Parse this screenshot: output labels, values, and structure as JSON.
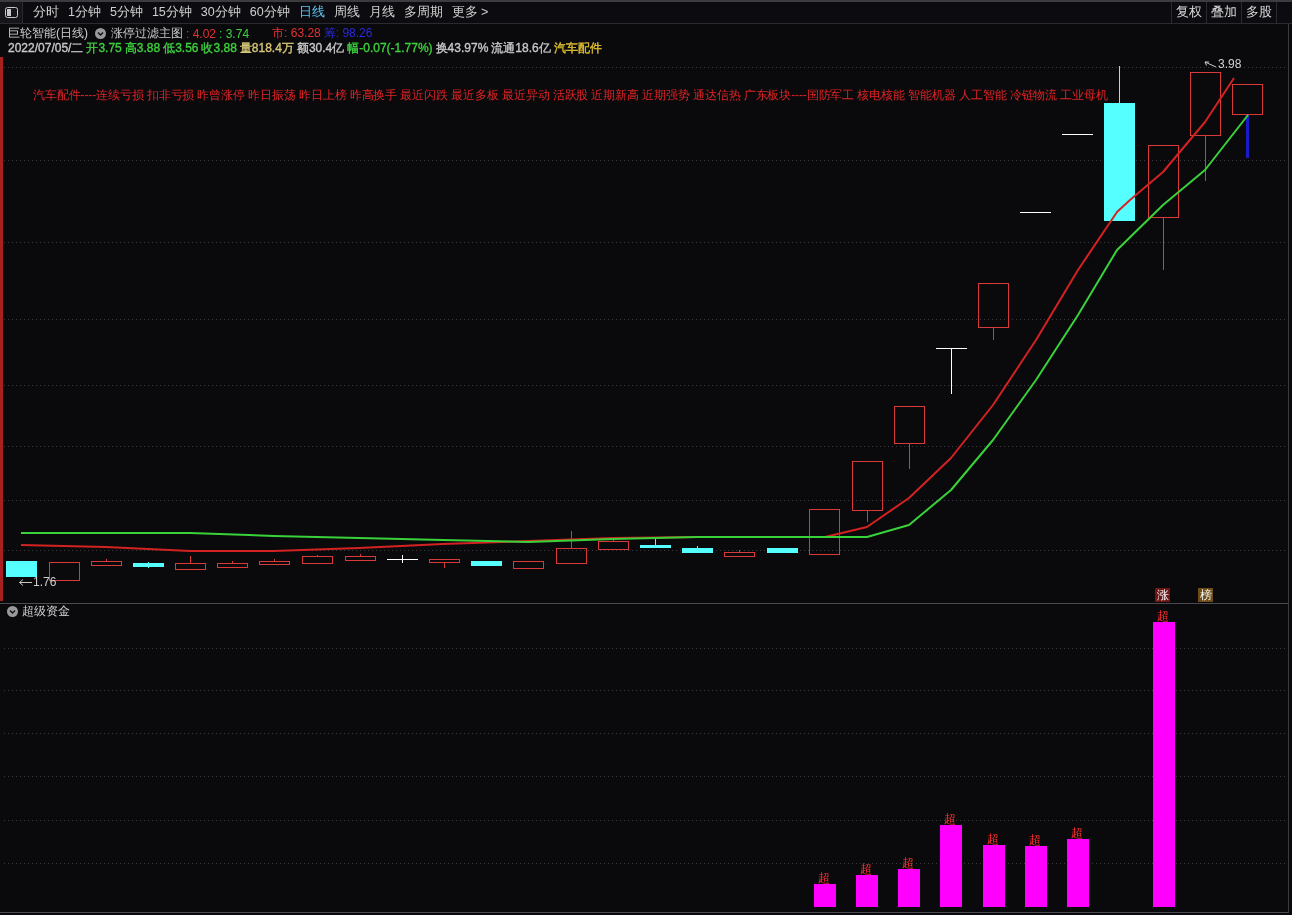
{
  "toolbar": {
    "tabs": [
      {
        "label": "分时",
        "selected": false
      },
      {
        "label": "1分钟",
        "selected": false
      },
      {
        "label": "5分钟",
        "selected": false
      },
      {
        "label": "15分钟",
        "selected": false
      },
      {
        "label": "30分钟",
        "selected": false
      },
      {
        "label": "60分钟",
        "selected": false
      },
      {
        "label": "日线",
        "selected": true
      },
      {
        "label": "周线",
        "selected": false
      },
      {
        "label": "月线",
        "selected": false
      },
      {
        "label": "多周期",
        "selected": false
      },
      {
        "label": "更多 >",
        "selected": false
      }
    ],
    "buttons": [
      "复权",
      "叠加",
      "多股"
    ]
  },
  "main_chart": {
    "title": "巨轮智能(日线)",
    "indicator_name": "涨停过滤主图",
    "indicator_values": [
      {
        "text": ": 4.02",
        "color": "#e03232"
      },
      {
        "text": ": 3.74",
        "color": "#3ed23e"
      },
      {
        "text": "市: 63.28",
        "color": "#e03232"
      },
      {
        "text": "筹: 98.26",
        "color": "#2a2ad8"
      }
    ],
    "quote": [
      {
        "text": "2022/07/05/二",
        "color": "#c8c8c8"
      },
      {
        "text": "开3.75",
        "color": "#3ed23e"
      },
      {
        "text": "高3.88",
        "color": "#3ed23e"
      },
      {
        "text": "低3.56",
        "color": "#3ed23e"
      },
      {
        "text": "收3.88",
        "color": "#3ed23e"
      },
      {
        "text": "量818.4万",
        "color": "#d8c878"
      },
      {
        "text": "额30.4亿",
        "color": "#c8c8c8"
      },
      {
        "text": "幅-0.07(-1.77%)",
        "color": "#3ed23e"
      },
      {
        "text": "换43.97%",
        "color": "#c8c8c8"
      },
      {
        "text": "流通18.6亿",
        "color": "#c8c8c8"
      },
      {
        "text": "汽车配件",
        "color": "#e0c030"
      }
    ],
    "concepts": "汽车配件----连续亏损 扣非亏损 昨曾涨停 昨日振荡 昨日上榜 昨高换手 最近闪跌 最近多板 最近异动 活跃股 近期新高 近期强势 通达信热 广东板块----国防军工 核电核能 智能机器 人工智能 冷链物流 工业母机",
    "low_label": "1.76",
    "high_label": "3.98",
    "signals": [
      {
        "text": "涨",
        "color": "#6e1616"
      },
      {
        "text": "榜",
        "color": "#6e4c18"
      }
    ]
  },
  "sub_chart": {
    "title": "超级资金",
    "bar_labels": [
      "超",
      "超",
      "超",
      "超",
      "超",
      "超",
      "超",
      "超"
    ]
  }
}
